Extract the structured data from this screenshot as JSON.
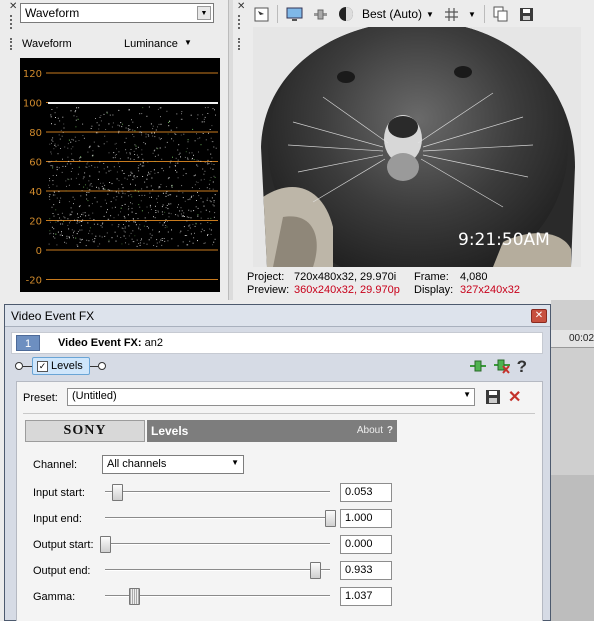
{
  "scope": {
    "type_value": "Waveform",
    "panel_label": "Waveform",
    "mode_label": "Luminance",
    "y_axis_ticks": [
      "120",
      "100",
      "80",
      "60",
      "40",
      "20",
      "0",
      "-20"
    ]
  },
  "preview": {
    "quality": "Best (Auto)",
    "timecode_overlay": "9:21:50AM",
    "project_label": "Project:",
    "project_value": "720x480x32, 29.970i",
    "preview_label": "Preview:",
    "preview_value": "360x240x32, 29.970p",
    "frame_label": "Frame:",
    "frame_value": "4,080",
    "display_label": "Display:",
    "display_value": "327x240x32",
    "accent_color": "#c8001a"
  },
  "fx_window": {
    "title": "Video Event FX",
    "chain_number": "1",
    "header_label": "Video Event FX:",
    "header_event": "an2",
    "plugin_chip": "Levels",
    "preset_label": "Preset:",
    "preset_value": "(Untitled)",
    "banner_brand": "SONY",
    "banner_plugin": "Levels",
    "banner_about": "About",
    "banner_help": "?",
    "channel_label": "Channel:",
    "channel_value": "All channels",
    "params": [
      {
        "label": "Input start:",
        "value": "0.053",
        "position": 0.053
      },
      {
        "label": "Input end:",
        "value": "1.000",
        "position": 1.0
      },
      {
        "label": "Output start:",
        "value": "0.000",
        "position": 0.0
      },
      {
        "label": "Output end:",
        "value": "0.933",
        "position": 0.933
      },
      {
        "label": "Gamma:",
        "value": "1.037",
        "position": 0.13
      }
    ]
  },
  "timeline": {
    "time_label": "00:02"
  },
  "icons": {
    "close": "close-icon",
    "plugin_add": "plugin-chain-add-icon",
    "plugin_remove": "plugin-chain-remove-icon",
    "help": "help-icon",
    "save": "save-icon",
    "delete": "delete-icon"
  }
}
